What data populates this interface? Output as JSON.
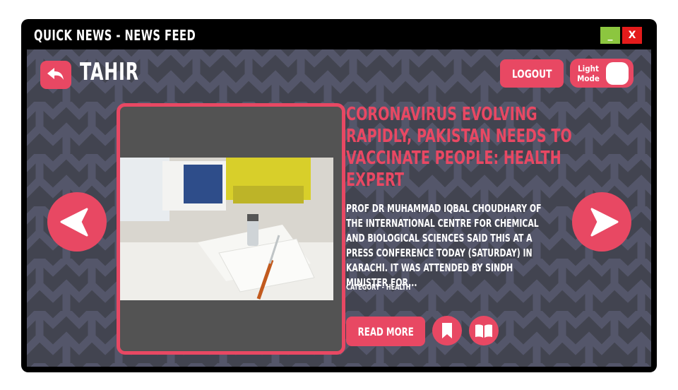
{
  "window": {
    "title": "Quick News - News Feed",
    "minimize_label": "_",
    "close_label": "X"
  },
  "header": {
    "username": "Tahir",
    "logout_label": "Logout",
    "theme_toggle_label": "Light Mode",
    "back_icon": "reply-arrow-icon"
  },
  "article": {
    "headline": "Coronavirus evolving rapidly, Pakistan needs to vaccinate people: health expert",
    "summary": "Prof Dr Muhammad Iqbal Choudhary of the International Centre for Chemical and Biological Sciences said this at a press conference today (Saturday) in Karachi. It was attended by Sindh Minister for...",
    "category": "Category - Health",
    "read_more_label": "Read More"
  },
  "icons": {
    "prev": "chevron-left-icon",
    "next": "chevron-right-icon",
    "bookmark": "bookmark-icon",
    "read": "open-book-icon"
  },
  "colors": {
    "accent": "#e84863",
    "background": "#424450",
    "window_frame": "#000000",
    "minimize": "#8cc63f",
    "close": "#e41b1b"
  }
}
